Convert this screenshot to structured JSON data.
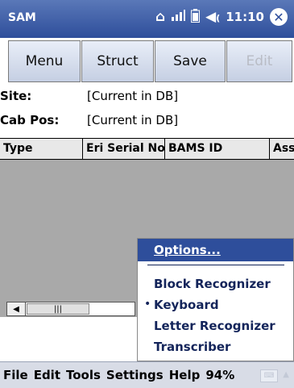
{
  "titlebar": {
    "app_title": "SAM",
    "time": "11:10",
    "icons": [
      "home-icon",
      "signal-icon",
      "battery-icon",
      "volume-icon",
      "close-icon"
    ]
  },
  "toolbar": {
    "menu_label": "Menu",
    "struct_label": "Struct",
    "save_label": "Save",
    "edit_label": "Edit"
  },
  "fields": {
    "site_label": "Site:",
    "site_value": "[Current in DB]",
    "cab_label": "Cab Pos:",
    "cab_value": "[Current in DB]"
  },
  "grid": {
    "columns": [
      "Type",
      "Eri Serial No",
      "BAMS ID",
      "Ass"
    ]
  },
  "scroll": {
    "left_arrow": "◀",
    "thumb_grip": "|||"
  },
  "popup": {
    "options": "Options...",
    "items": [
      "Block Recognizer",
      "Keyboard",
      "Letter Recognizer",
      "Transcriber"
    ],
    "selected": "Keyboard",
    "bullet": "•"
  },
  "bottom_menu": {
    "items": [
      "File",
      "Edit",
      "Tools",
      "Settings",
      "Help",
      "94%"
    ]
  },
  "colors": {
    "titlebar": "#2e4e9b",
    "menu_text": "#13245a",
    "grid_bg": "#a9a9a9"
  }
}
